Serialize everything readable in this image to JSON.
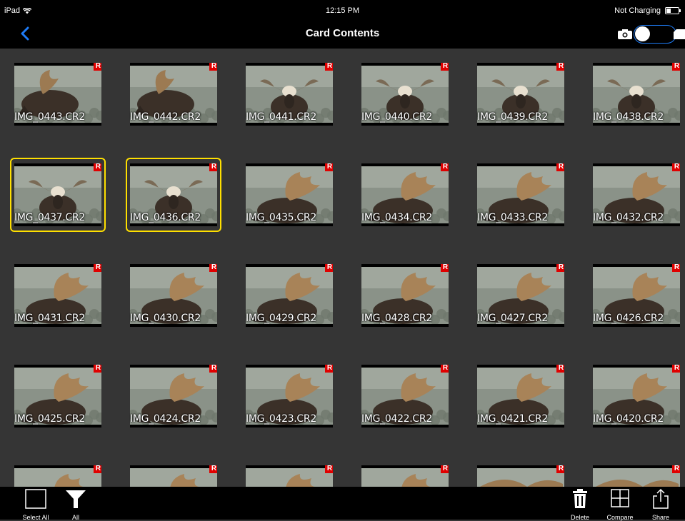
{
  "status_bar": {
    "device": "iPad",
    "time": "12:15 PM",
    "charging": "Not Charging"
  },
  "nav": {
    "title": "Card Contents",
    "back_icon": "chevron-left-icon",
    "mode": "card"
  },
  "grid": {
    "badge": "R",
    "items": [
      {
        "name": "IMG_0443.CR2",
        "selected": false,
        "variant": "moose-profile"
      },
      {
        "name": "IMG_0442.CR2",
        "selected": false,
        "variant": "moose-profile"
      },
      {
        "name": "IMG_0441.CR2",
        "selected": false,
        "variant": "moose-front"
      },
      {
        "name": "IMG_0440.CR2",
        "selected": false,
        "variant": "moose-front"
      },
      {
        "name": "IMG_0439.CR2",
        "selected": false,
        "variant": "moose-front"
      },
      {
        "name": "IMG_0438.CR2",
        "selected": false,
        "variant": "moose-front"
      },
      {
        "name": "IMG_0437.CR2",
        "selected": true,
        "variant": "moose-front"
      },
      {
        "name": "IMG_0436.CR2",
        "selected": true,
        "variant": "moose-front"
      },
      {
        "name": "IMG_0435.CR2",
        "selected": false,
        "variant": "moose-antler"
      },
      {
        "name": "IMG_0434.CR2",
        "selected": false,
        "variant": "moose-antler"
      },
      {
        "name": "IMG_0433.CR2",
        "selected": false,
        "variant": "moose-antler"
      },
      {
        "name": "IMG_0432.CR2",
        "selected": false,
        "variant": "moose-antler"
      },
      {
        "name": "IMG_0431.CR2",
        "selected": false,
        "variant": "moose-antler"
      },
      {
        "name": "IMG_0430.CR2",
        "selected": false,
        "variant": "moose-antler"
      },
      {
        "name": "IMG_0429.CR2",
        "selected": false,
        "variant": "moose-antler"
      },
      {
        "name": "IMG_0428.CR2",
        "selected": false,
        "variant": "moose-antler"
      },
      {
        "name": "IMG_0427.CR2",
        "selected": false,
        "variant": "moose-antler"
      },
      {
        "name": "IMG_0426.CR2",
        "selected": false,
        "variant": "moose-antler"
      },
      {
        "name": "IMG_0425.CR2",
        "selected": false,
        "variant": "moose-antler"
      },
      {
        "name": "IMG_0424.CR2",
        "selected": false,
        "variant": "moose-antler"
      },
      {
        "name": "IMG_0423.CR2",
        "selected": false,
        "variant": "moose-antler"
      },
      {
        "name": "IMG_0422.CR2",
        "selected": false,
        "variant": "moose-antler"
      },
      {
        "name": "IMG_0421.CR2",
        "selected": false,
        "variant": "moose-antler"
      },
      {
        "name": "IMG_0420.CR2",
        "selected": false,
        "variant": "moose-antler"
      },
      {
        "name": "",
        "selected": false,
        "variant": "moose-antler"
      },
      {
        "name": "",
        "selected": false,
        "variant": "moose-antler"
      },
      {
        "name": "",
        "selected": false,
        "variant": "moose-antler"
      },
      {
        "name": "",
        "selected": false,
        "variant": "moose-antler"
      },
      {
        "name": "",
        "selected": false,
        "variant": "moose-closeup"
      },
      {
        "name": "",
        "selected": false,
        "variant": "moose-closeup"
      }
    ]
  },
  "toolbar": {
    "select_all_label": "Select All",
    "filter_label": "All",
    "delete_label": "Delete",
    "compare_label": "Compare",
    "share_label": "Share"
  },
  "colors": {
    "background": "#353535",
    "bars": "#000000",
    "selection": "#ffe000",
    "raw_badge": "#e00000",
    "accent": "#1e7bf5"
  }
}
